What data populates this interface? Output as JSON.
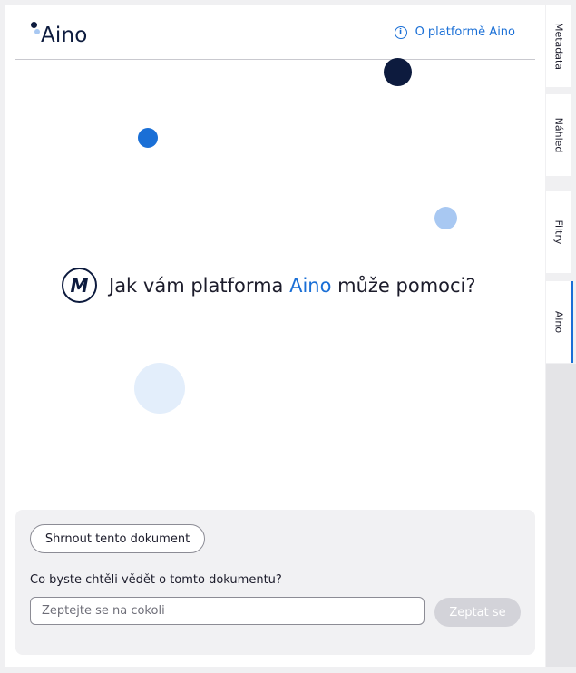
{
  "header": {
    "logo_text": "Aino",
    "about_link": "O platformě Aino",
    "info_icon_glyph": "i"
  },
  "hero": {
    "avatar_letter": "M",
    "title_before": "Jak vám platforma ",
    "title_accent": "Aino",
    "title_after": " může pomoci?"
  },
  "composer": {
    "summarize_label": "Shrnout tento dokument",
    "question_label": "Co byste chtěli vědět o tomto dokumentu?",
    "input_placeholder": "Zeptejte se na cokoli",
    "input_value": "",
    "ask_label": "Zeptat se"
  },
  "sidebar": {
    "tabs": [
      {
        "label": "Metadata",
        "active": false
      },
      {
        "label": "Náhled",
        "active": false
      },
      {
        "label": "Filtry",
        "active": false
      },
      {
        "label": "Aino",
        "active": true
      }
    ]
  },
  "colors": {
    "accent": "#1a6fd6",
    "navy": "#0d1b3e",
    "light_blue": "#a8c8f2",
    "pale_blue": "#e3eefb",
    "disabled": "#d3d3d9"
  }
}
